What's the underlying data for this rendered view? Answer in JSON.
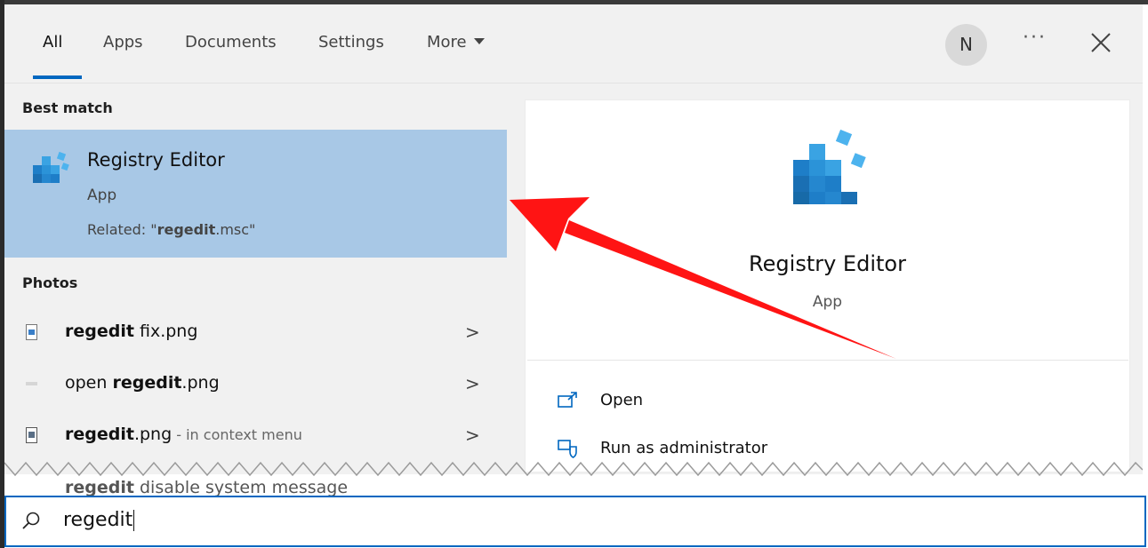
{
  "tabs": [
    {
      "label": "All",
      "active": true
    },
    {
      "label": "Apps"
    },
    {
      "label": "Documents"
    },
    {
      "label": "Settings"
    },
    {
      "label": "More"
    }
  ],
  "header": {
    "avatar_initial": "N",
    "more_options": "···"
  },
  "best_match": {
    "section_label": "Best match",
    "title": "Registry Editor",
    "type": "App",
    "related_prefix": "Related: \"",
    "related_bold": "regedit",
    "related_suffix": ".msc\""
  },
  "photos": {
    "section_label": "Photos",
    "items": [
      {
        "bold": "regedit",
        "rest": " fix.png",
        "context": ""
      },
      {
        "prefix": "open ",
        "bold": "regedit",
        "rest": ".png",
        "context": ""
      },
      {
        "bold": "regedit",
        "rest": ".png",
        "context": " - in context menu"
      },
      {
        "bold": "regedit",
        "rest": " disable system message"
      }
    ]
  },
  "preview": {
    "title": "Registry Editor",
    "type": "App"
  },
  "actions": [
    {
      "label": "Open"
    },
    {
      "label": "Run as administrator"
    }
  ],
  "search": {
    "query": "regedit"
  },
  "colors": {
    "accent": "#0067c0",
    "selected": "#a8c8e6",
    "annotation_arrow": "#ff1414"
  }
}
